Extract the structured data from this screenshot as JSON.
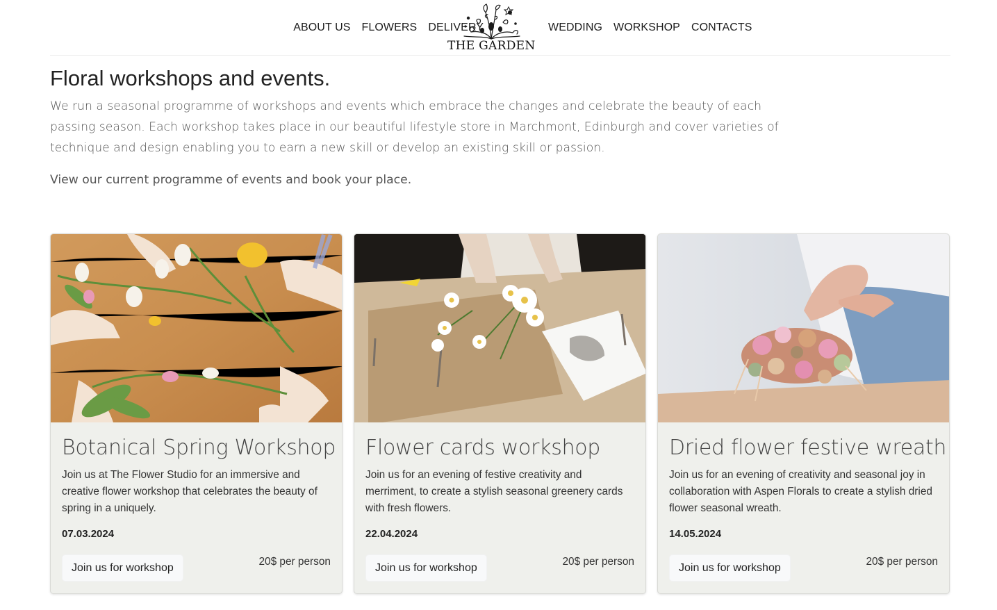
{
  "nav": {
    "left": [
      "ABOUT US",
      "FLOWERS",
      "DELIVERY"
    ],
    "right": [
      "WEDDING",
      "WORKSHOP",
      "CONTACTS"
    ],
    "logo_text": "THE GARDEN"
  },
  "intro": {
    "title": "Floral workshops and events.",
    "text": "We run a seasonal programme of workshops and events which embrace the changes and celebrate the beauty of each passing season. Each workshop takes place in our beautiful lifestyle store in Marchmont, Edinburgh and cover varieties of technique and design enabling you to earn a new skill or develop an existing skill or passion.",
    "cta": "View our current programme of events and book your place."
  },
  "cards": [
    {
      "title": "Botanical Spring Workshop",
      "text": "Join us at The Flower Studio for an immersive and creative flower workshop that celebrates the beauty of spring in a uniquely.",
      "date": "07.03.2024",
      "button": "Join us for workshop",
      "price": "20$ per person"
    },
    {
      "title": "Flower cards workshop",
      "text": "Join us for an evening of festive creativity and merriment, to create a stylish seasonal greenery cards with fresh flowers.",
      "date": "22.04.2024",
      "button": "Join us for workshop",
      "price": "20$ per person"
    },
    {
      "title": "Dried flower festive wreath",
      "text": "Join us for an evening of creativity and seasonal joy in collaboration with Aspen Florals to create a stylish dried flower seasonal wreath.",
      "date": "14.05.2024",
      "button": "Join us for workshop",
      "price": "20$ per person"
    }
  ]
}
